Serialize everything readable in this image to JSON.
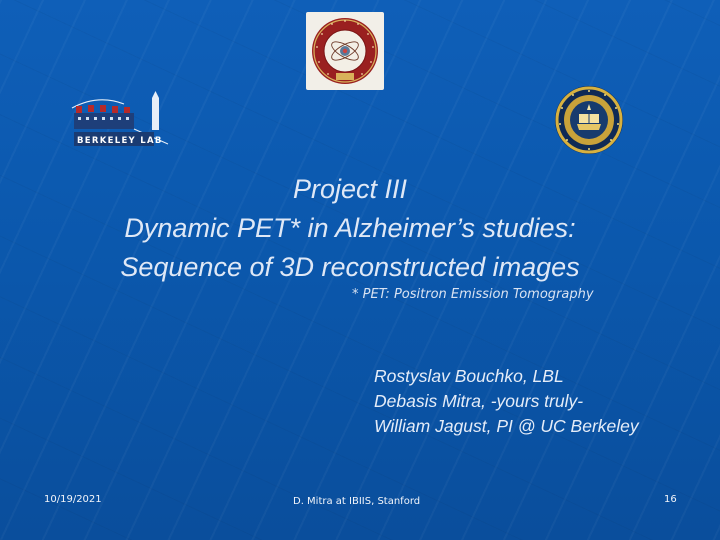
{
  "slide": {
    "title_lines": [
      "Project III",
      "Dynamic PET* in Alzheimer’s studies:",
      "Sequence of 3D reconstructed images"
    ],
    "footnote": "* PET: Positron Emission Tomography",
    "authors": [
      "Rostyslav Bouchko, LBL",
      "Debasis Mitra, -yours truly-",
      "William Jagust, PI @ UC Berkeley"
    ],
    "logos": {
      "lbl_text": "BERKELEY LAB"
    }
  },
  "footer": {
    "date": "10/19/2021",
    "center": "D. Mitra at IBIIS, Stanford",
    "page_number": "16"
  },
  "colors": {
    "background": "#0b58ad",
    "text": "#e4ecf8",
    "seal_red": "#8b1e1e",
    "seal_gold": "#c9a23a",
    "seal_navy": "#0f2a55"
  }
}
